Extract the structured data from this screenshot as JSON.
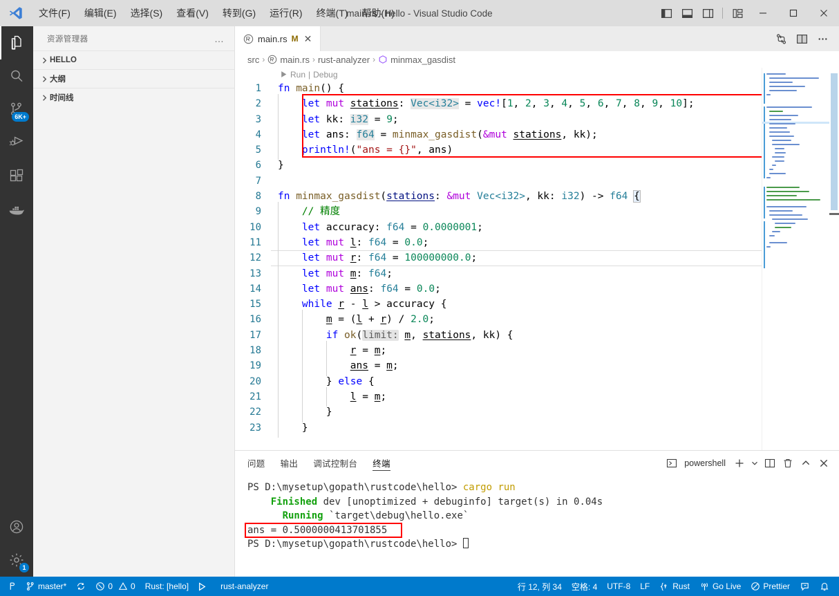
{
  "titlebar": {
    "title": "main.rs - hello - Visual Studio Code",
    "menus": [
      {
        "label": "文件(F)",
        "name": "menu-file"
      },
      {
        "label": "编辑(E)",
        "name": "menu-edit"
      },
      {
        "label": "选择(S)",
        "name": "menu-selection"
      },
      {
        "label": "查看(V)",
        "name": "menu-view"
      },
      {
        "label": "转到(G)",
        "name": "menu-go"
      },
      {
        "label": "运行(R)",
        "name": "menu-run"
      },
      {
        "label": "终端(T)",
        "name": "menu-terminal"
      },
      {
        "label": "帮助(H)",
        "name": "menu-help"
      }
    ],
    "layout_icons": [
      "toggle-primary-sidebar-icon",
      "toggle-panel-icon",
      "toggle-secondary-sidebar-icon",
      "customize-layout-icon"
    ],
    "window_buttons": [
      "minimize-icon",
      "maximize-icon",
      "close-icon"
    ]
  },
  "activitybar": {
    "items": [
      {
        "name": "explorer",
        "icon": "files-icon",
        "active": true
      },
      {
        "name": "search",
        "icon": "search-icon",
        "active": false
      },
      {
        "name": "source-control",
        "icon": "source-control-icon",
        "active": false,
        "badge": "6K+"
      },
      {
        "name": "run-and-debug",
        "icon": "debug-icon",
        "active": false
      },
      {
        "name": "extensions",
        "icon": "extensions-icon",
        "active": false
      },
      {
        "name": "docker",
        "icon": "docker-icon",
        "active": false
      }
    ],
    "bottom": [
      {
        "name": "accounts",
        "icon": "account-icon"
      },
      {
        "name": "manage",
        "icon": "gear-icon",
        "badge": "1"
      }
    ]
  },
  "sidebar": {
    "title": "资源管理器",
    "more_label": "…",
    "sections": [
      {
        "label": "HELLO",
        "name": "sidebar-section-hello",
        "expanded": false
      },
      {
        "label": "大纲",
        "name": "sidebar-section-outline",
        "expanded": false
      },
      {
        "label": "时间线",
        "name": "sidebar-section-timeline",
        "expanded": false
      }
    ]
  },
  "editor": {
    "tab": {
      "filename": "main.rs",
      "dirty_badge": "M",
      "close_label": "✕",
      "icon": "rust-file-icon"
    },
    "actions": [
      "compare-changes-icon",
      "split-editor-icon",
      "more-actions-icon"
    ],
    "breadcrumbs": [
      {
        "label": "src",
        "icon": ""
      },
      {
        "label": "main.rs",
        "icon": "rust-file-icon"
      },
      {
        "label": "rust-analyzer",
        "icon": ""
      },
      {
        "label": "minmax_gasdist",
        "icon": "symbol-method-icon"
      }
    ],
    "breadcrumb_separator": "›",
    "codelens": {
      "run": "Run",
      "separator": "|",
      "debug": "Debug",
      "play_icon": "play-icon"
    },
    "current_line": 12,
    "lines": [
      {
        "n": 1,
        "modified": true
      },
      {
        "n": 2,
        "modified": true
      },
      {
        "n": 3,
        "modified": true
      },
      {
        "n": 4,
        "modified": true
      },
      {
        "n": 5,
        "modified": true
      },
      {
        "n": 6,
        "modified": true
      },
      {
        "n": 7,
        "modified": false
      },
      {
        "n": 8,
        "modified": true
      },
      {
        "n": 9,
        "modified": true
      },
      {
        "n": 10,
        "modified": true
      },
      {
        "n": 11,
        "modified": true
      },
      {
        "n": 12,
        "modified": true
      },
      {
        "n": 13,
        "modified": true
      },
      {
        "n": 14,
        "modified": true
      },
      {
        "n": 15,
        "modified": true
      },
      {
        "n": 16,
        "modified": true
      },
      {
        "n": 17,
        "modified": true
      },
      {
        "n": 18,
        "modified": true
      },
      {
        "n": 19,
        "modified": true
      },
      {
        "n": 20,
        "modified": true
      },
      {
        "n": 21,
        "modified": true
      },
      {
        "n": 22,
        "modified": true
      },
      {
        "n": 23,
        "modified": true
      }
    ],
    "source_text": [
      "fn main() {",
      "    let mut stations: Vec<i32> = vec![1, 2, 3, 4, 5, 6, 7, 8, 9, 10];",
      "    let kk: i32 = 9;",
      "    let ans: f64 = minmax_gasdist(&mut stations, kk);",
      "    println!(\"ans = {}\", ans)",
      "}",
      "",
      "fn minmax_gasdist(stations: &mut Vec<i32>, kk: i32) -> f64 {",
      "    // 精度",
      "    let accuracy: f64 = 0.0000001;",
      "    let mut l: f64 = 0.0;",
      "    let mut r: f64 = 100000000.0;",
      "    let mut m: f64;",
      "    let mut ans: f64 = 0.0;",
      "    while r - l > accuracy {",
      "        m = (l + r) / 2.0;",
      "        if ok(m, stations, kk) {",
      "            r = m;",
      "            ans = m;",
      "        } else {",
      "            l = m;",
      "        }",
      "    }"
    ],
    "highlight_box": {
      "color": "#ff0000",
      "covers_lines": "2-5"
    }
  },
  "panel": {
    "tabs": [
      {
        "label": "问题",
        "name": "panel-tab-problems",
        "active": false
      },
      {
        "label": "输出",
        "name": "panel-tab-output",
        "active": false
      },
      {
        "label": "调试控制台",
        "name": "panel-tab-debug-console",
        "active": false
      },
      {
        "label": "终端",
        "name": "panel-tab-terminal",
        "active": true
      }
    ],
    "terminal_name": "powershell",
    "actions": [
      "new-terminal-icon",
      "chevron-down-icon",
      "split-terminal-icon",
      "kill-terminal-icon",
      "maximize-panel-icon",
      "close-panel-icon"
    ],
    "terminal_lines": [
      {
        "type": "prompt",
        "prompt": "PS D:\\mysetup\\gopath\\rustcode\\hello> ",
        "command": "cargo run"
      },
      {
        "type": "build",
        "status": "Finished",
        "rest": " dev [unoptimized + debuginfo] target(s) in 0.04s"
      },
      {
        "type": "build",
        "status": "  Running",
        "rest": " `target\\debug\\hello.exe`"
      },
      {
        "type": "output",
        "text": "ans = 0.5000000413701855",
        "highlighted": true
      },
      {
        "type": "prompt",
        "prompt": "PS D:\\mysetup\\gopath\\rustcode\\hello> ",
        "command": ""
      }
    ],
    "highlight_color": "#ff0000"
  },
  "statusbar": {
    "left": [
      {
        "name": "remote-indicator",
        "label": "",
        "icon": "remote-icon"
      },
      {
        "name": "branch",
        "label": "master*",
        "icon": "git-branch-icon"
      },
      {
        "name": "sync",
        "label": "",
        "icon": "sync-icon"
      },
      {
        "name": "problems",
        "label": "0",
        "icon": "error-icon",
        "label2": "0",
        "icon2": "warning-icon"
      },
      {
        "name": "rust-target",
        "label": "Rust: [hello]",
        "icon": ""
      },
      {
        "name": "run-target",
        "label": "",
        "icon": "play-icon"
      },
      {
        "name": "rust-analyzer",
        "label": "rust-analyzer",
        "icon": ""
      }
    ],
    "right": [
      {
        "name": "cursor-position",
        "label": "行 12, 列 34"
      },
      {
        "name": "indentation",
        "label": "空格: 4"
      },
      {
        "name": "encoding",
        "label": "UTF-8"
      },
      {
        "name": "eol",
        "label": "LF"
      },
      {
        "name": "language-mode",
        "label": "Rust",
        "icon": "rust-icon"
      },
      {
        "name": "go-live",
        "label": "Go Live",
        "icon": "broadcast-icon"
      },
      {
        "name": "prettier",
        "label": "Prettier",
        "icon": "prettier-icon"
      },
      {
        "name": "feedback",
        "label": "",
        "icon": "feedback-icon"
      },
      {
        "name": "notifications",
        "label": "",
        "icon": "bell-icon"
      }
    ]
  },
  "colors": {
    "accent": "#007acc",
    "titlebar_bg": "#dddddd",
    "activitybar_bg": "#333333",
    "sidebar_bg": "#f3f3f3",
    "editor_bg": "#ffffff",
    "highlight_red": "#ff0000",
    "keyword_blue": "#0000ff",
    "string_red": "#a31515",
    "number_green": "#098658",
    "comment_green": "#008000",
    "type_teal": "#267f99",
    "macro_purple": "#af00db"
  }
}
